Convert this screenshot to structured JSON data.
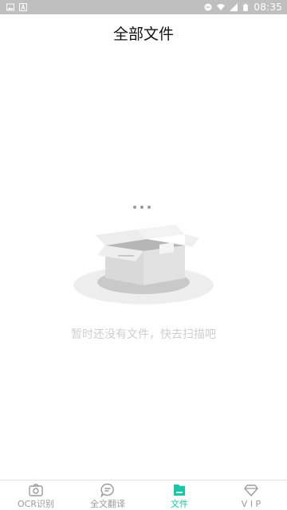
{
  "status_bar": {
    "time": "08:35",
    "left_icons": [
      "image-icon",
      "a-icon"
    ],
    "right_icons": [
      "minus-circle-icon",
      "wifi-icon",
      "signal-icon",
      "battery-icon"
    ]
  },
  "header": {
    "title": "全部文件"
  },
  "empty_state": {
    "message": "暂时还没有文件，快去扫描吧",
    "illustration": "open-box-icon"
  },
  "tabbar": {
    "active_color": "#19c7a6",
    "inactive_color": "#9b9b9b",
    "tabs": [
      {
        "label": "OCR识别",
        "icon": "camera-icon"
      },
      {
        "label": "全文翻译",
        "icon": "chat-translate-icon"
      },
      {
        "label": "文件",
        "icon": "folder-icon"
      },
      {
        "label": "V I P",
        "icon": "diamond-icon"
      }
    ]
  }
}
